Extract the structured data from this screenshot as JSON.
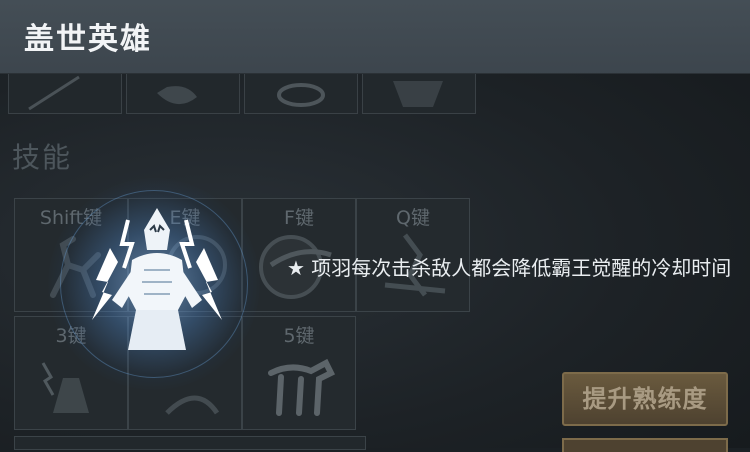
{
  "header": {
    "title": "盖世英雄"
  },
  "skills": {
    "section_label": "技能",
    "slots": [
      {
        "key": "Shift键",
        "icon": "running-warrior-icon"
      },
      {
        "key": "E键",
        "icon": "shield-strike-icon"
      },
      {
        "key": "F键",
        "icon": "spinning-blade-icon"
      },
      {
        "key": "Q键",
        "icon": "horse-charge-icon"
      },
      {
        "key": "3键",
        "icon": "lightning-warrior-icon"
      },
      {
        "key": "",
        "icon": "bow-archer-icon"
      },
      {
        "key": "5键",
        "icon": "horse-icon"
      }
    ],
    "selected": {
      "icon": "overlord-awaken-icon"
    },
    "description": "★ 项羽每次击杀敌人都会降低霸王觉醒的冷却时间"
  },
  "actions": {
    "upgrade_label": "提升熟练度"
  },
  "colors": {
    "accent": "#7d6b4a",
    "glow": "#8ec4ff",
    "title_bar": "#46505a"
  }
}
